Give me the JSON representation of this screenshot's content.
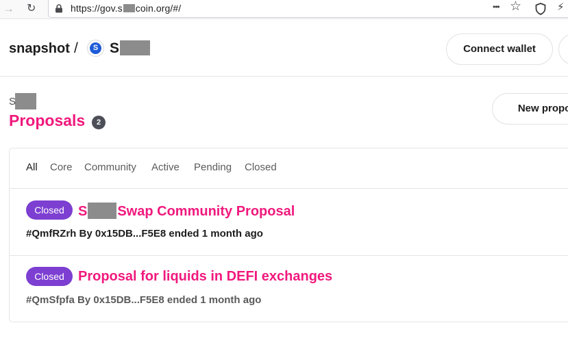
{
  "browser": {
    "url_prefix": "https://gov.s",
    "url_suffix": "coin.org/#/",
    "icons": [
      "forward-icon",
      "reload-icon",
      "lock-icon",
      "more-icon",
      "star-icon",
      "shield-icon",
      "extension-icon"
    ],
    "glyphs": {
      "forward": "→",
      "reload": "↻",
      "more": "•••",
      "star": "☆",
      "shield": "⛉",
      "extension": "⚡"
    }
  },
  "header": {
    "brand": "snapshot",
    "separator": "/",
    "space_avatar_letter": "S",
    "space_name_visible": "S",
    "connect_label": "Connect wallet"
  },
  "page": {
    "space_label_visible": "S",
    "title": "Proposals",
    "count": "2",
    "new_proposal_label": "New proposal"
  },
  "tabs": [
    {
      "label": "All",
      "active": true
    },
    {
      "label": "Core",
      "active": false
    },
    {
      "label": "Community",
      "active": false
    },
    {
      "label": "Active",
      "active": false
    },
    {
      "label": "Pending",
      "active": false
    },
    {
      "label": "Closed",
      "active": false
    }
  ],
  "proposals": [
    {
      "state": "Closed",
      "title_prefix": "S",
      "title_suffix": "Swap Community Proposal",
      "meta": "#QmfRZrh By 0x15DB...F5E8 ended 1 month ago"
    },
    {
      "state": "Closed",
      "title": "Proposal for liquids in DEFI exchanges",
      "meta": "#QmSfpfa By 0x15DB...F5E8 ended 1 month ago"
    }
  ],
  "colors": {
    "accent": "#f0197d",
    "closed_badge": "#7c3fd1",
    "count_badge": "#4d4f58",
    "redaction": "#8c8c8c"
  }
}
